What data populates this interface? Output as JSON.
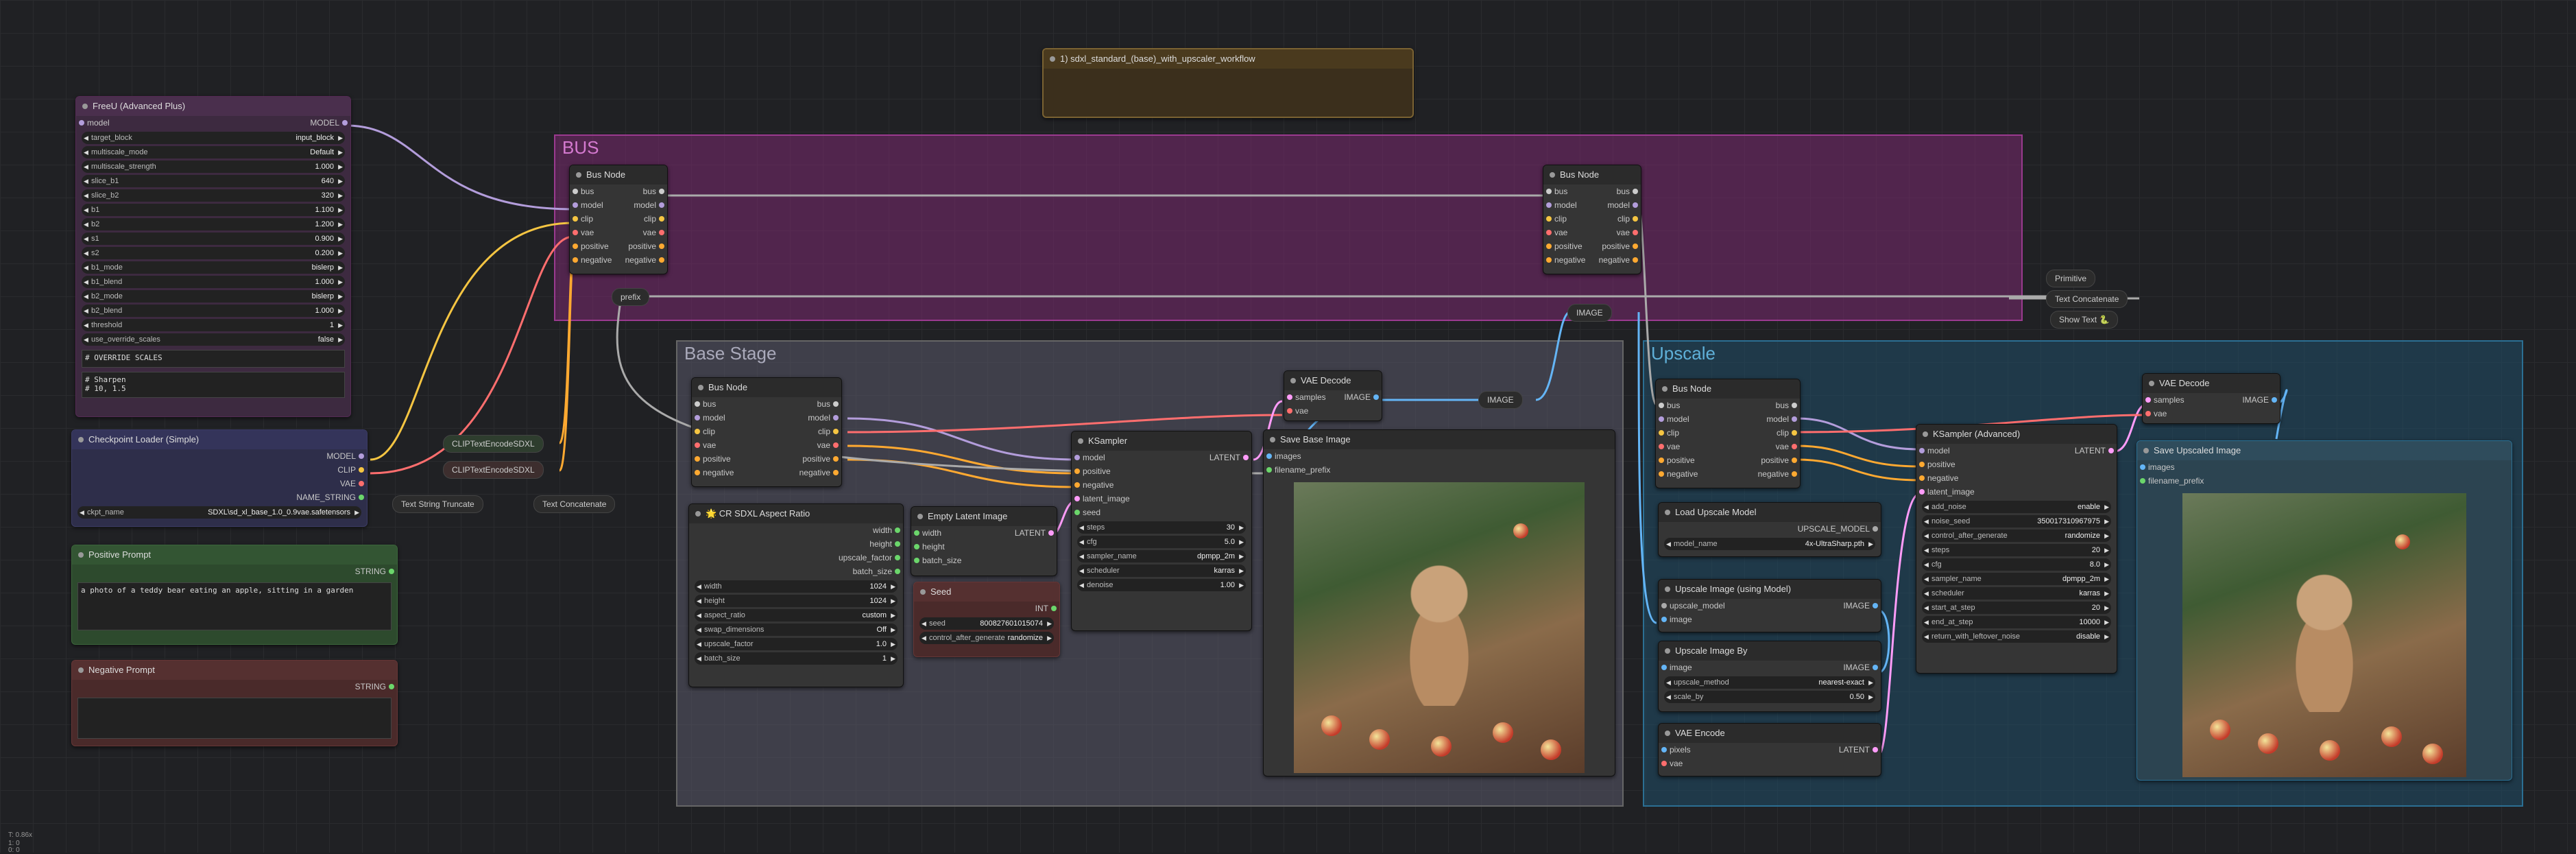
{
  "canvas": {
    "zoom_readout": "T: 0.86x",
    "coord_a": "1: 0",
    "coord_b": "0: 0"
  },
  "colors": {
    "bus": "#7a2a6f",
    "base": "#45454f",
    "upscale": "#1f4f68",
    "clip": "#f5c542",
    "model": "#b39ddb",
    "vae": "#ff6e6e",
    "cond": "#ffa931",
    "latent": "#ff9cf9",
    "image": "#64b5f6",
    "int": "#6bd66b"
  },
  "groups": {
    "bus": "BUS",
    "base": "Base Stage",
    "upscale": "Upscale"
  },
  "workflow_title": "1) sdxl_standard_(base)_with_upscaler_workflow",
  "freeu": {
    "title": "FreeU (Advanced Plus)",
    "in_model": "model",
    "out_model": "MODEL",
    "widgets": [
      {
        "label": "target_block",
        "value": "input_block"
      },
      {
        "label": "multiscale_mode",
        "value": "Default"
      },
      {
        "label": "multiscale_strength",
        "value": "1.000"
      },
      {
        "label": "slice_b1",
        "value": "640"
      },
      {
        "label": "slice_b2",
        "value": "320"
      },
      {
        "label": "b1",
        "value": "1.100"
      },
      {
        "label": "b2",
        "value": "1.200"
      },
      {
        "label": "s1",
        "value": "0.900"
      },
      {
        "label": "s2",
        "value": "0.200"
      },
      {
        "label": "b1_mode",
        "value": "bislerp"
      },
      {
        "label": "b1_blend",
        "value": "1.000"
      },
      {
        "label": "b2_mode",
        "value": "bislerp"
      },
      {
        "label": "b2_blend",
        "value": "1.000"
      },
      {
        "label": "threshold",
        "value": "1"
      },
      {
        "label": "use_override_scales",
        "value": "false"
      }
    ],
    "text1": "# OVERRIDE SCALES",
    "text2": "# Sharpen\n# 10, 1.5"
  },
  "checkpoint": {
    "title": "Checkpoint Loader (Simple)",
    "outs": [
      "MODEL",
      "CLIP",
      "VAE",
      "NAME_STRING"
    ],
    "widget_label": "ckpt_name",
    "widget_value": "SDXL\\sd_xl_base_1.0_0.9vae.safetensors"
  },
  "positive": {
    "title": "Positive Prompt",
    "out": "STRING",
    "text": "a photo of a teddy bear eating an apple, sitting in a garden"
  },
  "negative": {
    "title": "Negative Prompt",
    "out": "STRING",
    "text": ""
  },
  "clip1": "CLIPTextEncodeSDXL",
  "clip2": "CLIPTextEncodeSDXL",
  "truncate": "Text String Truncate",
  "concat1": "Text Concatenate",
  "busnode": {
    "title": "Bus Node",
    "rows": [
      "bus",
      "model",
      "clip",
      "vae",
      "positive",
      "negative"
    ]
  },
  "prefix": "prefix",
  "primitive": "Primitive",
  "concat2": "Text Concatenate",
  "showtext": "Show Text 🐍",
  "image_reroute": "IMAGE",
  "aspect": {
    "title": "🌟 CR SDXL Aspect Ratio",
    "outs": [
      "width",
      "height",
      "upscale_factor",
      "batch_size"
    ],
    "widgets": [
      {
        "label": "width",
        "value": "1024"
      },
      {
        "label": "height",
        "value": "1024"
      },
      {
        "label": "aspect_ratio",
        "value": "custom"
      },
      {
        "label": "swap_dimensions",
        "value": "Off"
      },
      {
        "label": "upscale_factor",
        "value": "1.0"
      },
      {
        "label": "batch_size",
        "value": "1"
      }
    ]
  },
  "empty_latent": {
    "title": "Empty Latent Image",
    "ins": [
      "width",
      "height",
      "batch_size"
    ],
    "out": "LATENT"
  },
  "seed": {
    "title": "Seed",
    "out": "INT",
    "widgets": [
      {
        "label": "seed",
        "value": "800827601015074"
      },
      {
        "label": "control_after_generate",
        "value": "randomize"
      }
    ]
  },
  "ksampler": {
    "title": "KSampler",
    "ins": [
      "model",
      "positive",
      "negative",
      "latent_image",
      "seed"
    ],
    "out": "LATENT",
    "widgets": [
      {
        "label": "steps",
        "value": "30"
      },
      {
        "label": "cfg",
        "value": "5.0"
      },
      {
        "label": "sampler_name",
        "value": "dpmpp_2m"
      },
      {
        "label": "scheduler",
        "value": "karras"
      },
      {
        "label": "denoise",
        "value": "1.00"
      }
    ]
  },
  "vae_decode1": {
    "title": "VAE Decode",
    "ins": [
      "samples",
      "vae"
    ],
    "out": "IMAGE"
  },
  "save_base": {
    "title": "Save Base Image",
    "ins": [
      "images",
      "filename_prefix"
    ]
  },
  "up_bus": {
    "title": "Bus Node"
  },
  "load_upscale": {
    "title": "Load Upscale Model",
    "out": "UPSCALE_MODEL",
    "widget_label": "model_name",
    "widget_value": "4x-UltraSharp.pth"
  },
  "upscale_using": {
    "title": "Upscale Image (using Model)",
    "ins": [
      "upscale_model",
      "image"
    ],
    "out": "IMAGE"
  },
  "upscale_by": {
    "title": "Upscale Image By",
    "in": "image",
    "out": "IMAGE",
    "widgets": [
      {
        "label": "upscale_method",
        "value": "nearest-exact"
      },
      {
        "label": "scale_by",
        "value": "0.50"
      }
    ]
  },
  "vae_encode": {
    "title": "VAE Encode",
    "ins": [
      "pixels",
      "vae"
    ],
    "out": "LATENT"
  },
  "ksampler_adv": {
    "title": "KSampler (Advanced)",
    "ins": [
      "model",
      "positive",
      "negative",
      "latent_image"
    ],
    "out": "LATENT",
    "widgets": [
      {
        "label": "add_noise",
        "value": "enable"
      },
      {
        "label": "noise_seed",
        "value": "350017310967975"
      },
      {
        "label": "control_after_generate",
        "value": "randomize"
      },
      {
        "label": "steps",
        "value": "20"
      },
      {
        "label": "cfg",
        "value": "8.0"
      },
      {
        "label": "sampler_name",
        "value": "dpmpp_2m"
      },
      {
        "label": "scheduler",
        "value": "karras"
      },
      {
        "label": "start_at_step",
        "value": "20"
      },
      {
        "label": "end_at_step",
        "value": "10000"
      },
      {
        "label": "return_with_leftover_noise",
        "value": "disable"
      }
    ]
  },
  "vae_decode2": {
    "title": "VAE Decode",
    "ins": [
      "samples",
      "vae"
    ],
    "out": "IMAGE"
  },
  "save_up": {
    "title": "Save Upscaled Image",
    "ins": [
      "images",
      "filename_prefix"
    ]
  }
}
